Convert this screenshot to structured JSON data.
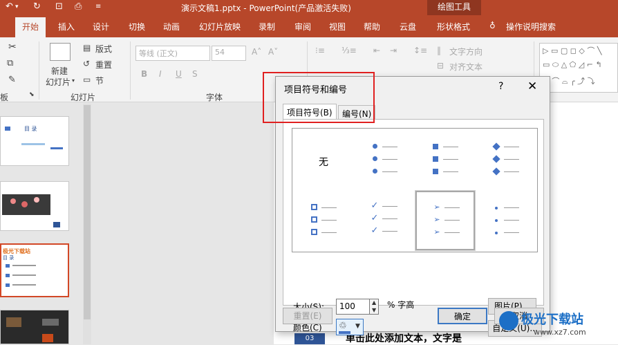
{
  "titlebar": {
    "title": "演示文稿1.pptx  -  PowerPoint(产品激活失败)",
    "drawing_tools": "绘图工具"
  },
  "tabs": [
    "开始",
    "插入",
    "设计",
    "切换",
    "动画",
    "幻灯片放映",
    "录制",
    "审阅",
    "视图",
    "帮助",
    "云盘",
    "形状格式"
  ],
  "tell_me": "操作说明搜索",
  "ribbon": {
    "clipboard_group": "板",
    "new_slide": "新建",
    "new_slide2": "幻灯片",
    "layout": "版式",
    "reset": "重置",
    "section": "节",
    "slides_group": "幻灯片",
    "font_name": "等线 (正文)",
    "font_size": "54",
    "font_group": "字体",
    "text_direction": "文字方向",
    "align_text": "对齐文本",
    "bold": "B",
    "italic": "I",
    "underline": "U",
    "strike": "S"
  },
  "thumbs": {
    "t1_title": "目    录",
    "t3_title": "极光下载站",
    "t3_sub": "目  录"
  },
  "dialog": {
    "title": "项目符号和编号",
    "help": "?",
    "close": "✕",
    "tab_bullets": "项目符号(B)",
    "tab_numbering": "编号(N)",
    "none_label": "无",
    "size_label": "大小(S):",
    "size_value": "100",
    "size_unit": "% 字高",
    "color_label": "颜色(C)",
    "picture_btn": "图片(P)...",
    "custom_btn": "自定义(U)...",
    "reset_btn": "重置(E)",
    "ok_btn": "确定",
    "cancel_btn": "取消"
  },
  "slide": {
    "number": "03",
    "text": "单击此处添加文本，文字是"
  },
  "watermark": {
    "name": "极光下载站",
    "url": "www.xz7.com"
  },
  "colors": {
    "accent": "#b7472a",
    "bullet": "#4472c4",
    "highlight_box": "#e02020"
  }
}
